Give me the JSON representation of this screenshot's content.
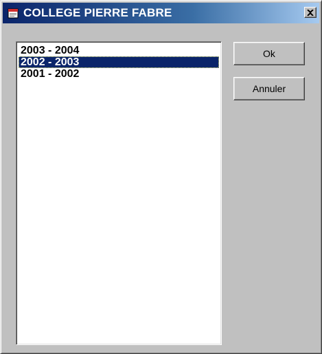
{
  "window": {
    "title": "COLLEGE PIERRE FABRE",
    "icon": "app-window-icon",
    "close_icon": "close-icon"
  },
  "years_list": {
    "items": [
      {
        "label": "2003 - 2004",
        "selected": false
      },
      {
        "label": "2002 - 2003",
        "selected": true
      },
      {
        "label": "2001 - 2002",
        "selected": false
      }
    ]
  },
  "buttons": {
    "ok_label": "Ok",
    "cancel_label": "Annuler"
  },
  "colors": {
    "title_bar": "#0a246a",
    "selection": "#0a246a",
    "dialog_bg": "#c0c0c0"
  }
}
